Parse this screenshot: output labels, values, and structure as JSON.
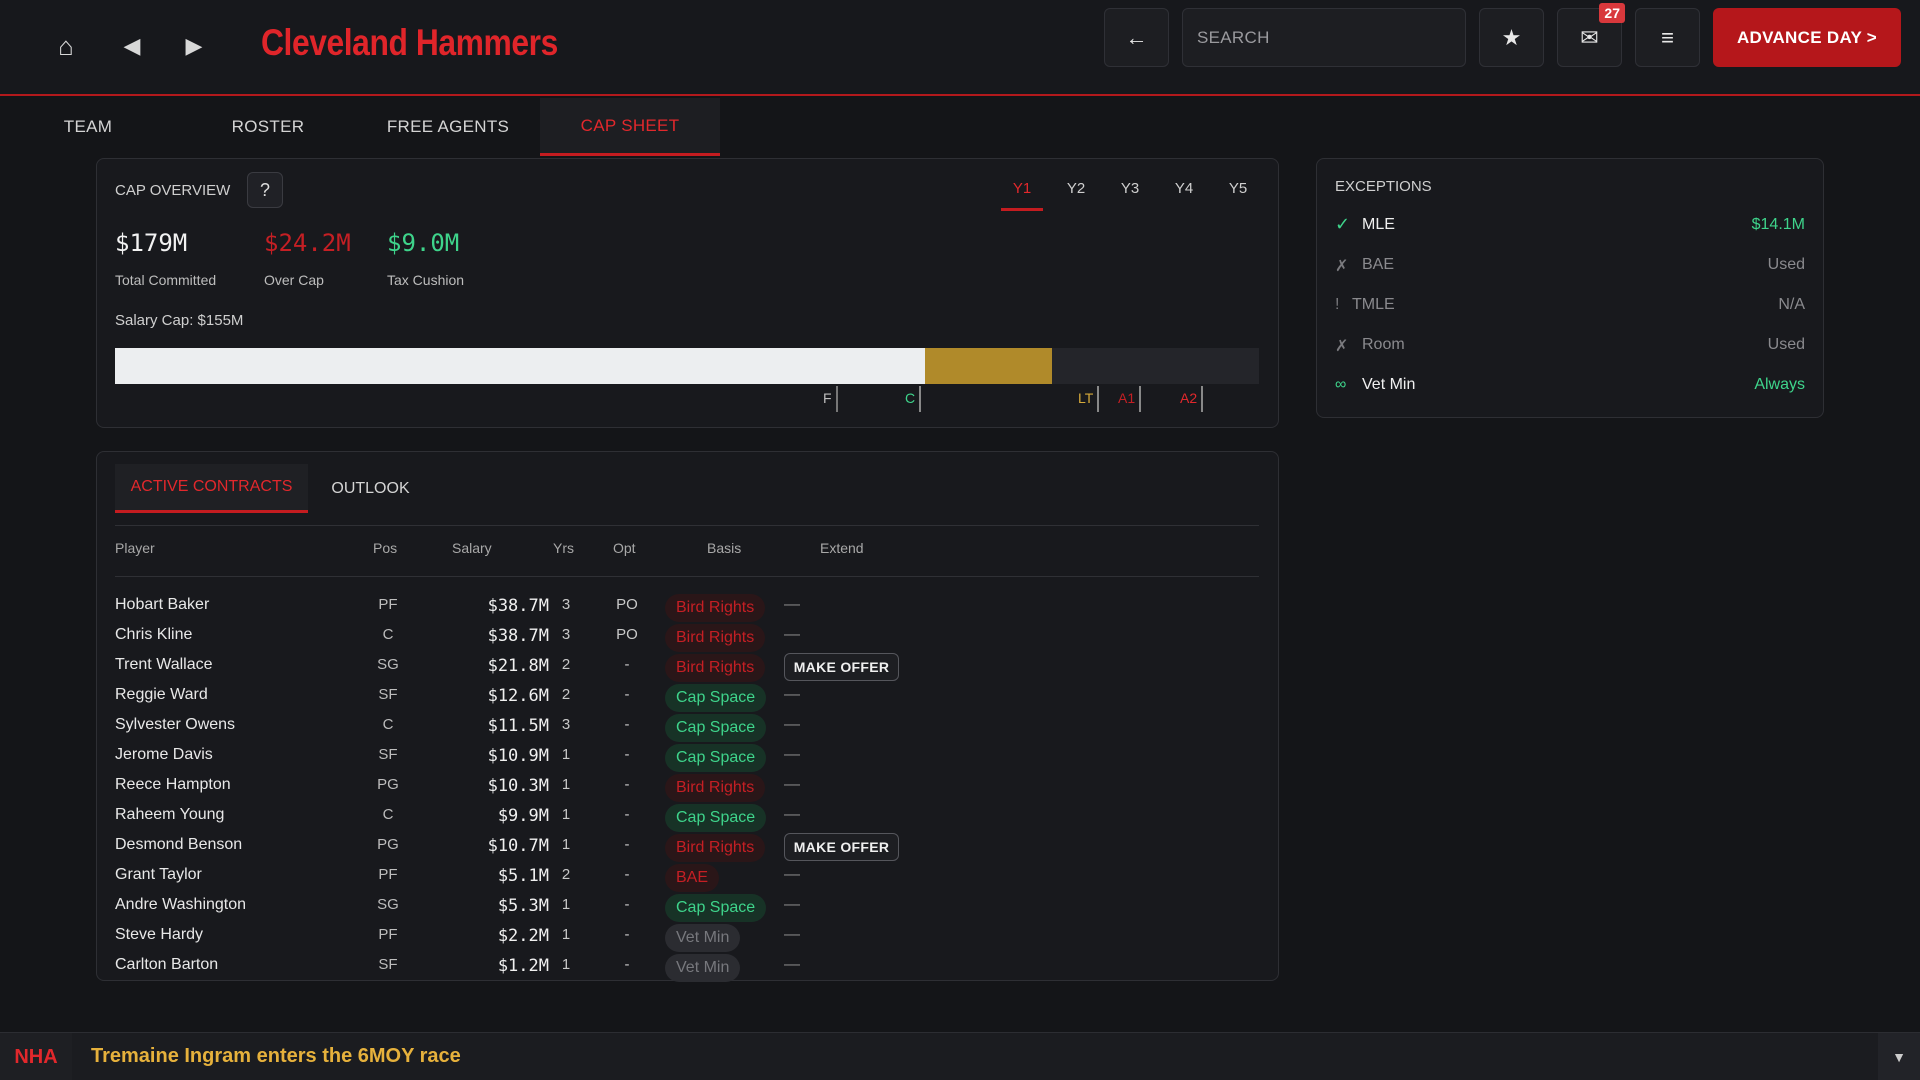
{
  "header": {
    "team_name": "Cleveland Hammers",
    "search_placeholder": "SEARCH",
    "inbox_count": "27",
    "advance_label": "ADVANCE DAY >",
    "back_arrow": "←",
    "star": "★",
    "mail": "✉",
    "menu": "≡",
    "home": "⌂",
    "prev": "◀",
    "next": "▶"
  },
  "tabs": [
    "TEAM",
    "ROSTER",
    "FREE AGENTS",
    "CAP SHEET"
  ],
  "active_tab": "CAP SHEET",
  "cap_overview": {
    "title": "CAP OVERVIEW",
    "help": "?",
    "years": [
      "Y1",
      "Y2",
      "Y3",
      "Y4",
      "Y5"
    ],
    "active_year": "Y1",
    "total_committed": "$179M",
    "total_committed_label": "Total Committed",
    "over_cap": "$24.2M",
    "over_cap_label": "Over Cap",
    "tax_cushion": "$9.0M",
    "tax_cushion_label": "Tax Cushion",
    "salary_cap_text": "Salary Cap: $155M",
    "bar": {
      "committed_fraction": 0.708,
      "over_fraction": 0.111
    },
    "markers": [
      "F",
      "C",
      "LT",
      "A1",
      "A2"
    ]
  },
  "contracts": {
    "tabs": [
      "ACTIVE CONTRACTS",
      "OUTLOOK"
    ],
    "active_tab": "ACTIVE CONTRACTS",
    "columns": [
      "Player",
      "Pos",
      "Salary",
      "Yrs",
      "Opt",
      "Basis",
      "Extend"
    ],
    "rows": [
      {
        "player": "Hobart Baker",
        "pos": "PF",
        "salary": "$38.7M",
        "yrs": "3",
        "opt": "PO",
        "basis": "Bird Rights",
        "extend": "—"
      },
      {
        "player": "Chris Kline",
        "pos": "C",
        "salary": "$38.7M",
        "yrs": "3",
        "opt": "PO",
        "basis": "Bird Rights",
        "extend": "—"
      },
      {
        "player": "Trent Wallace",
        "pos": "SG",
        "salary": "$21.8M",
        "yrs": "2",
        "opt": "-",
        "basis": "Bird Rights",
        "extend": "MAKE OFFER"
      },
      {
        "player": "Reggie Ward",
        "pos": "SF",
        "salary": "$12.6M",
        "yrs": "2",
        "opt": "-",
        "basis": "Cap Space",
        "extend": "—"
      },
      {
        "player": "Sylvester Owens",
        "pos": "C",
        "salary": "$11.5M",
        "yrs": "3",
        "opt": "-",
        "basis": "Cap Space",
        "extend": "—"
      },
      {
        "player": "Jerome Davis",
        "pos": "SF",
        "salary": "$10.9M",
        "yrs": "1",
        "opt": "-",
        "basis": "Cap Space",
        "extend": "—"
      },
      {
        "player": "Reece Hampton",
        "pos": "PG",
        "salary": "$10.3M",
        "yrs": "1",
        "opt": "-",
        "basis": "Bird Rights",
        "extend": "—"
      },
      {
        "player": "Raheem Young",
        "pos": "C",
        "salary": "$9.9M",
        "yrs": "1",
        "opt": "-",
        "basis": "Cap Space",
        "extend": "—"
      },
      {
        "player": "Desmond Benson",
        "pos": "PG",
        "salary": "$10.7M",
        "yrs": "1",
        "opt": "-",
        "basis": "Bird Rights",
        "extend": "MAKE OFFER"
      },
      {
        "player": "Grant Taylor",
        "pos": "PF",
        "salary": "$5.1M",
        "yrs": "2",
        "opt": "-",
        "basis": "BAE",
        "extend": "—"
      },
      {
        "player": "Andre Washington",
        "pos": "SG",
        "salary": "$5.3M",
        "yrs": "1",
        "opt": "-",
        "basis": "Cap Space",
        "extend": "—"
      },
      {
        "player": "Steve Hardy",
        "pos": "PF",
        "salary": "$2.2M",
        "yrs": "1",
        "opt": "-",
        "basis": "Vet Min",
        "extend": "—"
      },
      {
        "player": "Carlton Barton",
        "pos": "SF",
        "salary": "$1.2M",
        "yrs": "1",
        "opt": "-",
        "basis": "Vet Min",
        "extend": "—"
      }
    ]
  },
  "exceptions": {
    "title": "EXCEPTIONS",
    "items": [
      {
        "icon": "✓",
        "name": "MLE",
        "value": "$14.1M",
        "status": "available"
      },
      {
        "icon": "✗",
        "name": "BAE",
        "value": "Used",
        "status": "used"
      },
      {
        "icon": "!",
        "name": "TMLE",
        "value": "N/A",
        "status": "na"
      },
      {
        "icon": "✗",
        "name": "Room",
        "value": "Used",
        "status": "used"
      },
      {
        "icon": "∞",
        "name": "Vet Min",
        "value": "Always",
        "status": "always"
      }
    ]
  },
  "ticker": {
    "league": "NHA",
    "headline": "Tremaine Ingram enters the 6MOY race",
    "toggle": "▼"
  },
  "colors": {
    "accent": "#e2282c",
    "gold": "#b08a2a",
    "green": "#3ed48b",
    "ticker_text": "#e6b13c"
  }
}
